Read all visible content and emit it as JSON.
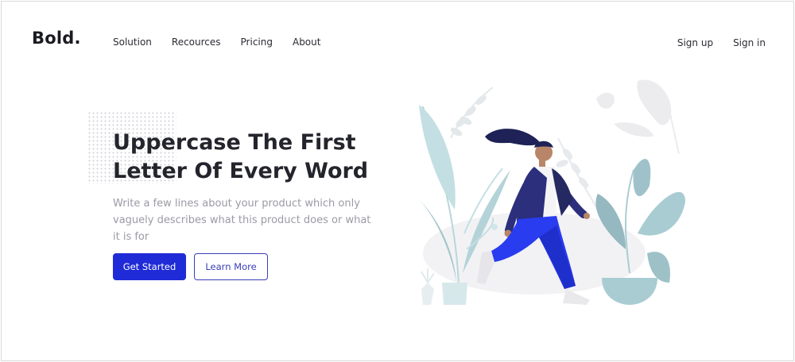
{
  "header": {
    "logo": "Bold.",
    "nav": [
      "Solution",
      "Recources",
      "Pricing",
      "About"
    ],
    "auth": {
      "signup": "Sign up",
      "signin": "Sign in"
    }
  },
  "hero": {
    "headline": "Uppercase The First Letter Of Every Word",
    "subtext": "Write a few lines about your product which only vaguely describes what this product does or what it is for",
    "primary_label": "Get Started",
    "secondary_label": "Learn More"
  },
  "colors": {
    "accent": "#1f2bd6",
    "plant": "#a9ccd3",
    "figure_jacket": "#2b2f7c",
    "figure_pants": "#2a3cf0"
  }
}
